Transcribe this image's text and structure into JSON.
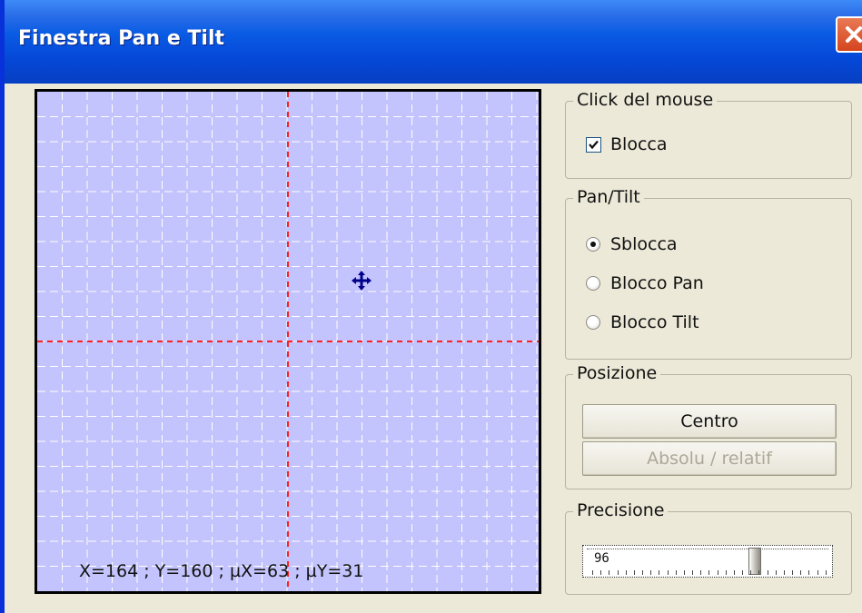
{
  "window": {
    "title": "Finestra Pan e Tilt",
    "close_icon": "close-icon"
  },
  "canvas": {
    "coord_text": "X=164 ; Y=160 ; µX=63 ; µY=31",
    "background": "#c3c3fd",
    "crosshair_color": "#ff2020",
    "grid_color": "#ffffff",
    "marker_icon": "move-cross-icon",
    "marker_color": "#00008b"
  },
  "mouse_click": {
    "title": "Click del mouse",
    "block_label": "Blocca",
    "block_checked": true
  },
  "pan_tilt": {
    "title": "Pan/Tilt",
    "options": [
      {
        "label": "Sblocca",
        "selected": true
      },
      {
        "label": "Blocco Pan",
        "selected": false
      },
      {
        "label": "Blocco Tilt",
        "selected": false
      }
    ]
  },
  "position": {
    "title": "Posizione",
    "center_label": "Centro",
    "abs_rel_label": "Absolu / relatif"
  },
  "precision": {
    "title": "Precisione",
    "value": "96",
    "level_fraction": 0.7
  }
}
